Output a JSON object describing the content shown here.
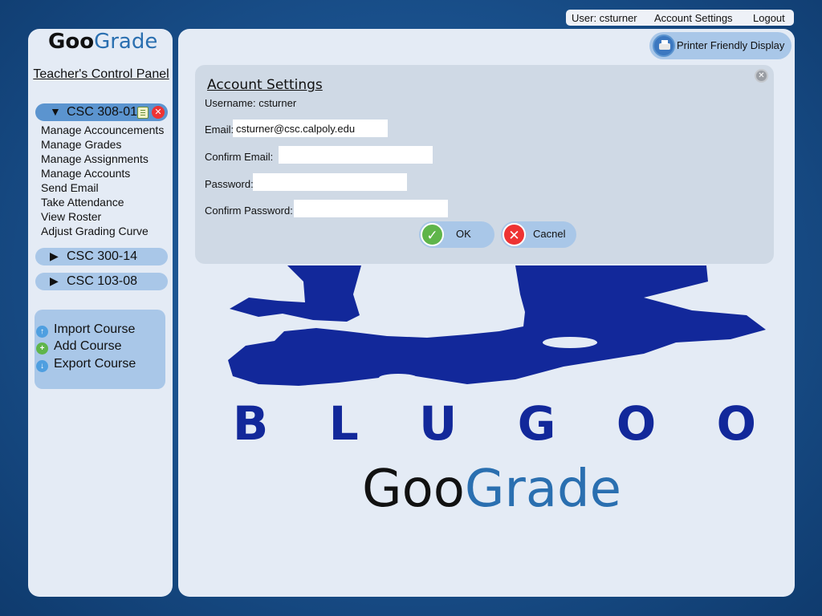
{
  "top_bar": {
    "user_label": "User: csturner",
    "account_settings": "Account Settings",
    "logout": "Logout"
  },
  "sidebar": {
    "logo": {
      "part_dark": "Goo",
      "part_blue": "Grade"
    },
    "panel_title": "Teacher's Control Panel",
    "courses": [
      {
        "name": "CSC 308-01",
        "expanded": true,
        "arrow": "▼"
      },
      {
        "name": "CSC 300-14",
        "expanded": false,
        "arrow": "▶"
      },
      {
        "name": "CSC 103-08",
        "expanded": false,
        "arrow": "▶"
      }
    ],
    "course_menu": [
      "Manage Accouncements",
      "Manage Grades",
      "Manage Assignments",
      "Manage Accounts",
      "Send Email",
      "Take Attendance",
      "View Roster",
      "Adjust Grading Curve"
    ],
    "tools": [
      {
        "label": "Import Course",
        "icon": "up-arrow-icon",
        "color": "#4f9fe0"
      },
      {
        "label": "Add Course",
        "icon": "plus-icon",
        "color": "#5fb54a"
      },
      {
        "label": "Export Course",
        "icon": "down-arrow-icon",
        "color": "#4f9fe0"
      }
    ]
  },
  "main": {
    "printer_button": "Printer Friendly Display",
    "dialog": {
      "title": "Account Settings",
      "username_label": "Username:",
      "username_value": "csturner",
      "email_label": "Email:",
      "email_value": "csturner@csc.calpoly.edu",
      "confirm_email_label": "Confirm Email:",
      "confirm_email_value": "",
      "password_label": "Password:",
      "password_value": "",
      "confirm_password_label": "Confirm Password:",
      "confirm_password_value": "",
      "ok_label": "OK",
      "cancel_label": "Cacnel"
    },
    "brand": {
      "blugoo_letters": [
        "B",
        "L",
        "U",
        "G",
        "O",
        "O"
      ],
      "logo_dark": "Goo",
      "logo_blue": "Grade"
    }
  },
  "colors": {
    "accent_blue": "#5b94cf",
    "light_blue": "#a9c7e8",
    "panel_bg": "#e4ebf5",
    "brand_navy": "#12289a",
    "ok_green": "#5fb54a",
    "cancel_red": "#e33"
  }
}
